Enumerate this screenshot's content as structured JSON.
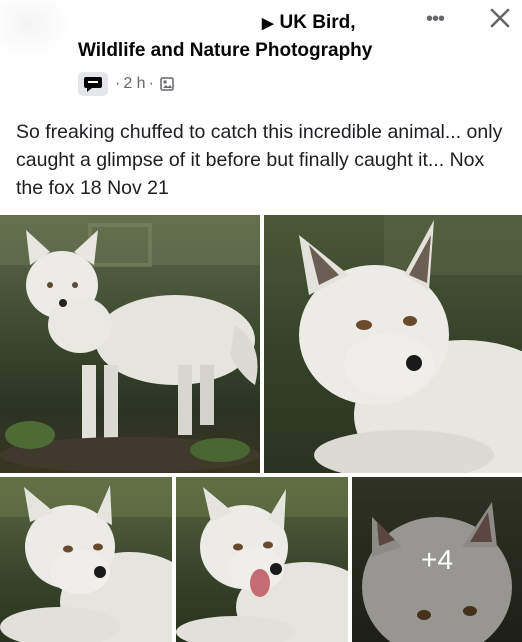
{
  "post": {
    "group_name_line1": "UK Bird,",
    "group_name_line2": "Wildlife and Nature Photography",
    "time": "2 h",
    "more_label": "•••",
    "text": "So freaking chuffed to catch this incredible animal... only caught a glimpse of it before but finally caught it... Nox the fox 18 Nov 21"
  },
  "photos": {
    "extra_count": "+4"
  },
  "icons": {
    "badge": "chat-bubble-icon",
    "audience": "gallery-icon",
    "close": "close-icon",
    "arrow": "right-arrow-icon"
  },
  "colors": {
    "text": "#050505",
    "meta": "#65676b",
    "badge_bg": "#e4e6eb"
  }
}
